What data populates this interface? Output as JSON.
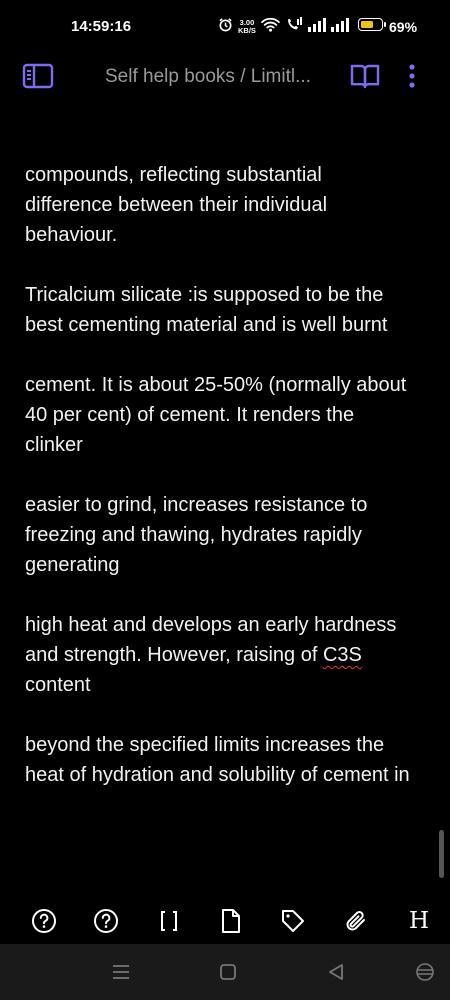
{
  "status_bar": {
    "time": "14:59:16",
    "net_speed_value": "3.00",
    "net_speed_unit": "KB/S",
    "battery_percent": "69%",
    "battery_level": 0.69,
    "icons": [
      "alarm-icon",
      "net-speed",
      "wifi-icon",
      "volte-call-icon",
      "signal-icon",
      "signal-icon",
      "battery-icon"
    ]
  },
  "header": {
    "breadcrumb": "Self help books / Limitl...",
    "icons": [
      "sidebar-toggle-icon",
      "reading-view-icon",
      "more-vert-icon"
    ],
    "accent_color": "#7c6cf0"
  },
  "content": {
    "paragraphs": [
      "compounds, reflecting substantial difference between their individual behaviour.",
      "Tricalcium silicate :is supposed to be the best cementing material and is well burnt",
      "cement. It is about 25-50% (normally about 40 per cent) of cement. It renders the clinker",
      "easier to grind, increases resistance to freezing and thawing, hydrates rapidly generating"
    ],
    "para5_before": "high heat and develops an early hardness and strength. However, raising of ",
    "para5_underlined": "C3S",
    "para5_after": " content",
    "para6": "beyond the specified limits increases the heat of hydration and solubility of cement in"
  },
  "toolbar": {
    "icons": [
      "help-circle-icon",
      "help-circle-icon",
      "brackets-icon",
      "file-icon",
      "tag-icon",
      "paperclip-icon",
      "heading-icon"
    ],
    "heading_label": "H"
  },
  "nav_bar": {
    "icons": [
      "menu-icon",
      "home-square-icon",
      "back-triangle-icon",
      "accessibility-icon"
    ]
  }
}
